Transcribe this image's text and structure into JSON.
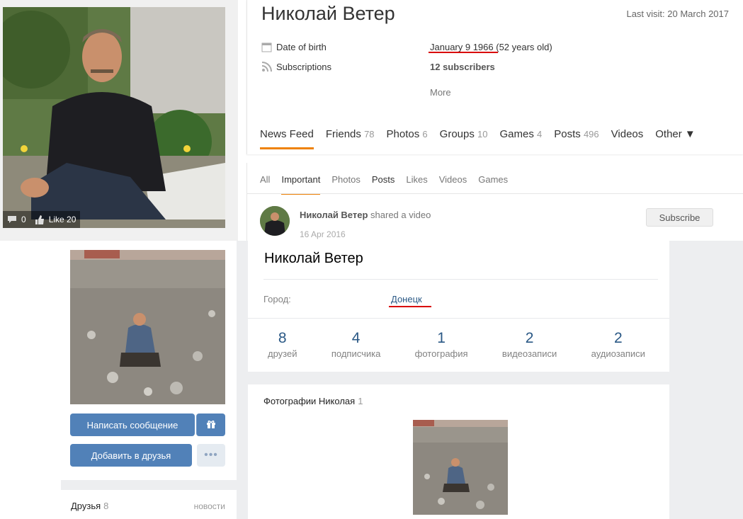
{
  "ok": {
    "name": "Николай Ветер",
    "last_visit": "Last visit: 20 March 2017",
    "avatar_comments": "0",
    "avatar_likes": "Like 20",
    "info": {
      "dob_label": "Date of birth",
      "dob_value": "January 9 1966",
      "dob_age": " (52 years old)",
      "subs_label": "Subscriptions",
      "subs_value": "12 subscribers",
      "more": "More"
    },
    "tabs": [
      {
        "label": "News Feed",
        "count": ""
      },
      {
        "label": "Friends",
        "count": "78"
      },
      {
        "label": "Photos",
        "count": "6"
      },
      {
        "label": "Groups",
        "count": "10"
      },
      {
        "label": "Games",
        "count": "4"
      },
      {
        "label": "Posts",
        "count": "496"
      },
      {
        "label": "Videos",
        "count": ""
      },
      {
        "label": "Other ▼",
        "count": ""
      }
    ],
    "subtabs": [
      "All",
      "Important",
      "Photos",
      "Posts",
      "Likes",
      "Videos",
      "Games"
    ],
    "post": {
      "author": "Николай Ветер",
      "action": " shared a video",
      "date": "16 Apr 2016",
      "subscribe": "Subscribe"
    }
  },
  "vk": {
    "name": "Николай Ветер",
    "city_label": "Город:",
    "city_value": "Донецк",
    "counters": [
      {
        "num": "8",
        "label": "друзей"
      },
      {
        "num": "4",
        "label": "подписчика"
      },
      {
        "num": "1",
        "label": "фотография"
      },
      {
        "num": "2",
        "label": "видеозаписи"
      },
      {
        "num": "2",
        "label": "аудиозаписи"
      }
    ],
    "btn_message": "Написать сообщение",
    "btn_add": "Добавить в друзья",
    "btn_more": "•••",
    "friends_title": "Друзья",
    "friends_count": "8",
    "friends_link": "новости",
    "photos_title": "Фотографии Николая",
    "photos_count": "1"
  },
  "colors": {
    "ok_accent": "#ee8208",
    "vk_blue": "#5181b8",
    "vk_link": "#2a5885",
    "red_underline": "#d80000"
  }
}
